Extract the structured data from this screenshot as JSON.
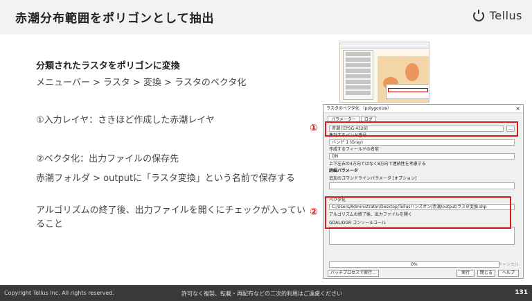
{
  "header": {
    "title": "赤潮分布範囲をポリゴンとして抽出",
    "brand": "Tellus"
  },
  "content": {
    "subtitle": "分類されたラスタをポリゴンに変換",
    "lines": [
      "メニューバー > ラスタ > 変換 > ラスタのベクタ化",
      "①入力レイヤ：さきほど作成した赤潮レイヤ",
      "②ベクタ化：出力ファイルの保存先",
      "赤潮フォルダ > outputに「ラスタ変換」という名前で保存する",
      "アルゴリズムの終了後、出力ファイルを開くにチェックが入っていること"
    ]
  },
  "dialog": {
    "title": "ラスタのベクタ化 （polygonize）",
    "tabs": [
      "パラメーター",
      "ログ"
    ],
    "input_layer": "赤潮 [EPSG:4326]",
    "band_label": "集計するバンド番号",
    "band_value": "バンド 1 (Gray)",
    "field_label": "作成するフィールドの名前",
    "field_value": "DN",
    "option_8dir": "上下左右の4方向ではなく8方向で連続性を考慮する",
    "advanced": "詳細パラメータ",
    "extra_label": "追加のコマンドラインパラメータ [オプション]",
    "vector_label": "ベクタ化",
    "output_path": "C:/Users/Administrator/Desktop/Tellusハンズオン/赤潮/output/ラスタ変換.shp",
    "open_output": "アルゴリズムの終了後、出力ファイルを開く",
    "gdal_label": "GDAL/OGR コンソールコール",
    "progress_text": "0%",
    "cancel_label": "キャンセル",
    "batch_label": "バッチプロセスで実行...",
    "run_label": "実行",
    "close_label": "閉じる",
    "help_label": "ヘルプ"
  },
  "markers": {
    "one": "①",
    "two": "②"
  },
  "footer": {
    "copyright": "Copyright Tellus Inc. All rights reserved.",
    "notice": "許可なく複製、転載・再配布などの二次的利用はご遠慮ください",
    "page": "131"
  },
  "colors": {
    "accent": "#d81b1b",
    "footer_bg": "#3a3a3a",
    "header_bg": "#f2f2f2"
  }
}
